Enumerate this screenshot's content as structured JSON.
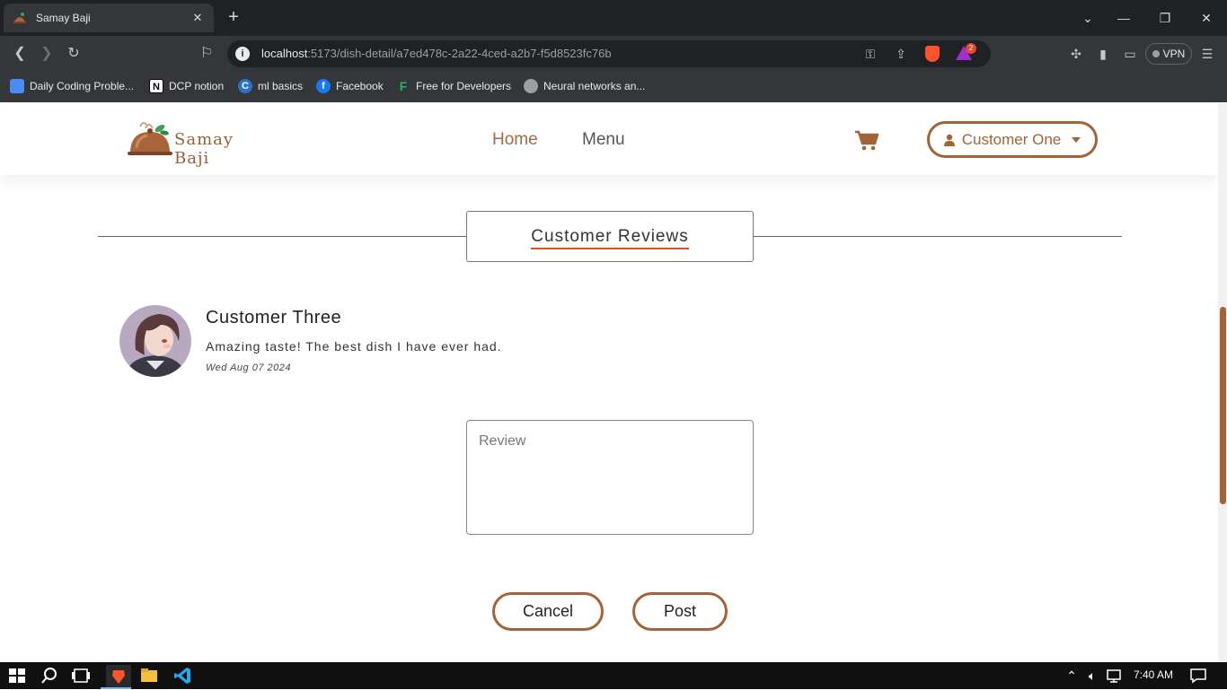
{
  "browser": {
    "tab_title": "Samay Baji",
    "url_host": "localhost",
    "url_rest": ":5173/dish-detail/a7ed478c-2a22-4ced-a2b7-f5d8523fc76b",
    "rewards_count": "2",
    "vpn_label": "VPN",
    "bookmarks": [
      {
        "label": "Daily Coding Proble...",
        "icon": "puzzle-icon",
        "color": "#4c8bf5"
      },
      {
        "label": "DCP notion",
        "icon": "notion-icon",
        "color": "#ffffff"
      },
      {
        "label": "ml basics",
        "icon": "coursera-icon",
        "color": "#2a73cc"
      },
      {
        "label": "Facebook",
        "icon": "facebook-icon",
        "color": "#1877f2"
      },
      {
        "label": "Free for Developers",
        "icon": "f-icon",
        "color": "#1fb85a"
      },
      {
        "label": "Neural networks an...",
        "icon": "globe-icon",
        "color": "#9aa0a6"
      }
    ]
  },
  "site": {
    "brand": "Samay Baji",
    "nav": {
      "home": "Home",
      "menu": "Menu"
    },
    "user_name": "Customer One",
    "accent": "#a36336"
  },
  "reviews": {
    "section_title": "Customer Reviews",
    "items": [
      {
        "name": "Customer Three",
        "text": "Amazing taste! The best dish I have ever had.",
        "date": "Wed Aug 07 2024"
      }
    ],
    "input_placeholder": "Review",
    "cancel_label": "Cancel",
    "post_label": "Post"
  },
  "taskbar": {
    "time": "7:40 AM"
  }
}
